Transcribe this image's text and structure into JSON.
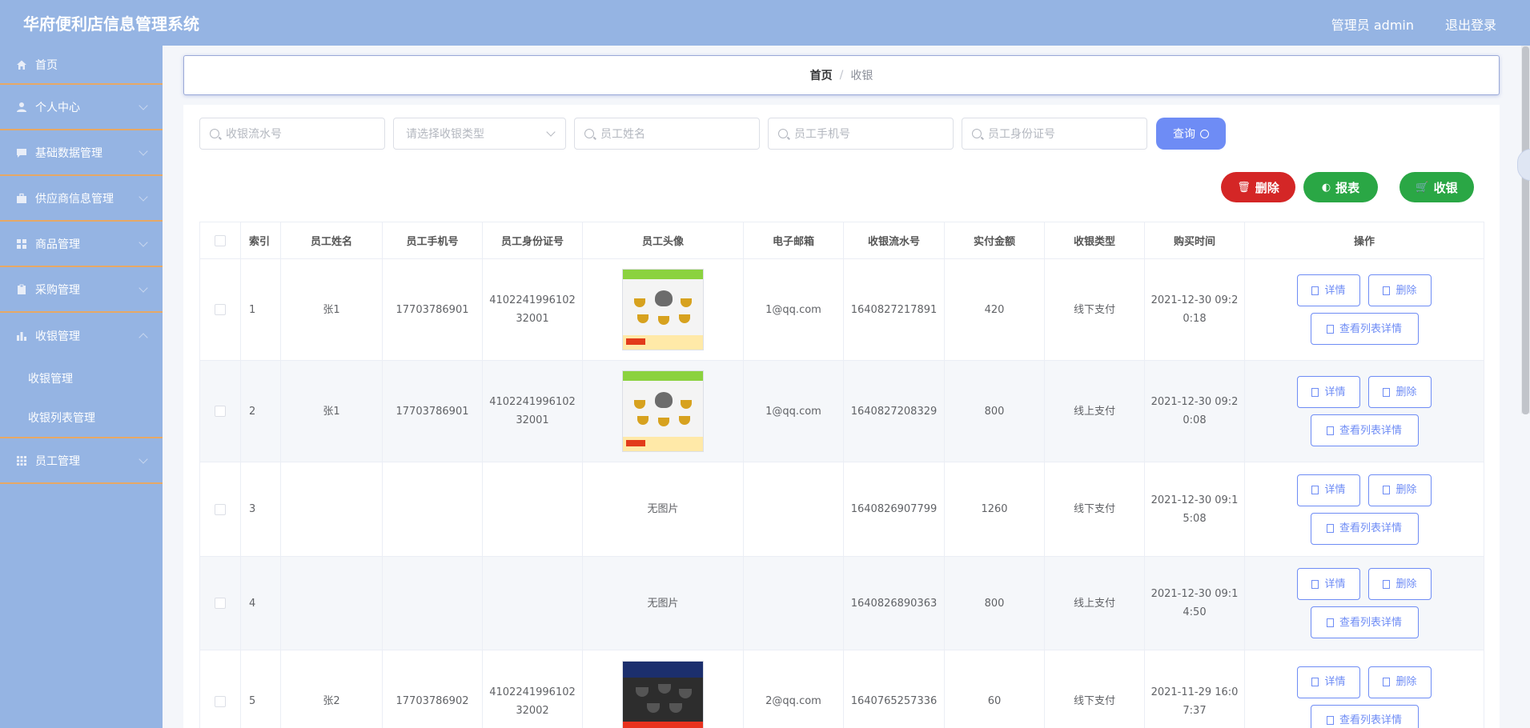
{
  "app": {
    "title": "华府便利店信息管理系统",
    "user_label": "管理员 admin",
    "logout_label": "退出登录"
  },
  "sidebar": {
    "items": [
      {
        "label": "首页",
        "icon": "home-icon"
      },
      {
        "label": "个人中心",
        "icon": "user-icon"
      },
      {
        "label": "基础数据管理",
        "icon": "message-icon"
      },
      {
        "label": "供应商信息管理",
        "icon": "briefcase-icon"
      },
      {
        "label": "商品管理",
        "icon": "grid-icon"
      },
      {
        "label": "采购管理",
        "icon": "clipboard-icon"
      },
      {
        "label": "收银管理",
        "icon": "bar-chart-icon"
      },
      {
        "label": "员工管理",
        "icon": "apps-icon"
      }
    ],
    "subitems": [
      {
        "label": "收银管理"
      },
      {
        "label": "收银列表管理"
      }
    ]
  },
  "breadcrumb": {
    "home": "首页",
    "separator": "/",
    "current": "收银"
  },
  "search": {
    "serial_placeholder": "收银流水号",
    "type_placeholder": "请选择收银类型",
    "name_placeholder": "员工姓名",
    "phone_placeholder": "员工手机号",
    "idcard_placeholder": "员工身份证号",
    "query_label": "查询"
  },
  "actions": {
    "delete_label": "删除",
    "report_label": "报表",
    "cashier_label": "收银"
  },
  "table": {
    "headers": [
      "索引",
      "员工姓名",
      "员工手机号",
      "员工身份证号",
      "员工头像",
      "电子邮箱",
      "收银流水号",
      "实付金额",
      "收银类型",
      "购买时间",
      "操作"
    ],
    "rows": [
      {
        "index": "1",
        "name": "张1",
        "phone": "17703786901",
        "id_line1": "4102241996102",
        "id_line2": "32001",
        "avatar": "tea-set",
        "avatar_text": "",
        "email": "1@qq.com",
        "serial": "1640827217891",
        "amount": "420",
        "type": "线下支付",
        "time_line1": "2021-12-30 09:2",
        "time_line2": "0:18"
      },
      {
        "index": "2",
        "name": "张1",
        "phone": "17703786901",
        "id_line1": "4102241996102",
        "id_line2": "32001",
        "avatar": "tea-set",
        "avatar_text": "",
        "email": "1@qq.com",
        "serial": "1640827208329",
        "amount": "800",
        "type": "线上支付",
        "time_line1": "2021-12-30 09:2",
        "time_line2": "0:08"
      },
      {
        "index": "3",
        "name": "",
        "phone": "",
        "id_line1": "",
        "id_line2": "",
        "avatar": "none",
        "avatar_text": "无图片",
        "email": "",
        "serial": "1640826907799",
        "amount": "1260",
        "type": "线下支付",
        "time_line1": "2021-12-30 09:1",
        "time_line2": "5:08"
      },
      {
        "index": "4",
        "name": "",
        "phone": "",
        "id_line1": "",
        "id_line2": "",
        "avatar": "none",
        "avatar_text": "无图片",
        "email": "",
        "serial": "1640826890363",
        "amount": "800",
        "type": "线上支付",
        "time_line1": "2021-12-30 09:1",
        "time_line2": "4:50"
      },
      {
        "index": "5",
        "name": "张2",
        "phone": "17703786902",
        "id_line1": "4102241996102",
        "id_line2": "32002",
        "avatar": "dark-tea-set",
        "avatar_text": "",
        "email": "2@qq.com",
        "serial": "1640765257336",
        "amount": "60",
        "type": "线下支付",
        "time_line1": "2021-11-29 16:0",
        "time_line2": "7:37"
      }
    ],
    "op_detail": "详情",
    "op_delete": "删除",
    "op_list": "查看列表详情"
  },
  "colors": {
    "header_bg": "#95b4e3",
    "accent_blue": "#6e8cf5",
    "danger": "#d42626",
    "success": "#2aa745",
    "menu_divider": "#e6a866"
  }
}
